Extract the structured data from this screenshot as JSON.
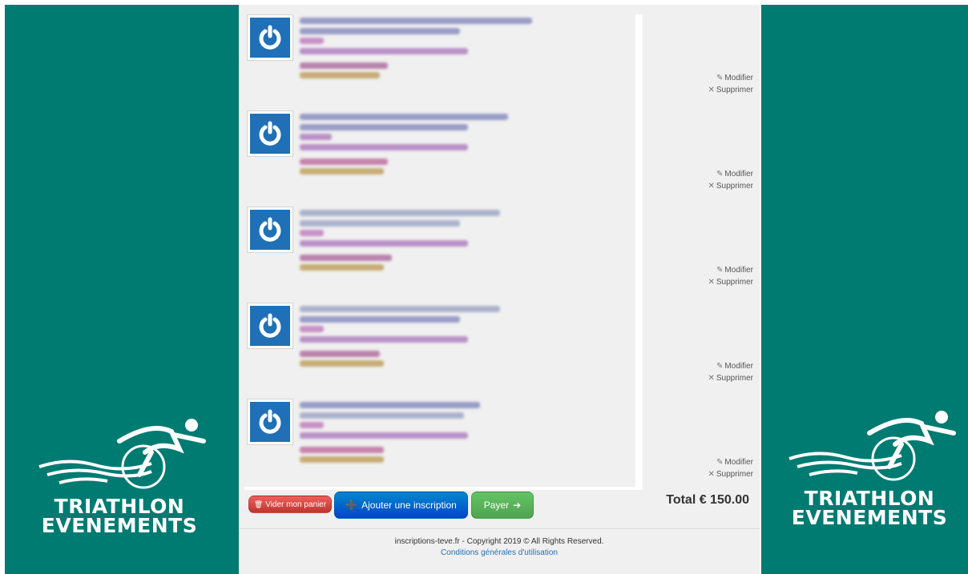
{
  "brand": {
    "logo_line1": "TRIATHLON",
    "logo_line2": "EVENEMENTS",
    "bg_color": "#007b72"
  },
  "cart": {
    "items": [
      {
        "edit_label": "Modifier",
        "delete_label": "Supprimer",
        "thumb_icon": "power-icon"
      },
      {
        "edit_label": "Modifier",
        "delete_label": "Supprimer",
        "thumb_icon": "power-icon"
      },
      {
        "edit_label": "Modifier",
        "delete_label": "Supprimer",
        "thumb_icon": "power-icon"
      },
      {
        "edit_label": "Modifier",
        "delete_label": "Supprimer",
        "thumb_icon": "power-icon"
      },
      {
        "edit_label": "Modifier",
        "delete_label": "Supprimer",
        "thumb_icon": "power-icon"
      }
    ],
    "clear_label": "Vider mon panier",
    "add_label": "Ajouter une inscription",
    "pay_label": "Payer",
    "total_text": "Total € 150.00"
  },
  "colors": {
    "clear": "#bd362f",
    "add": "#0044cc",
    "pay": "#51a351",
    "thumb": "#1f70b7"
  },
  "footer": {
    "copyright": "inscriptions-teve.fr - Copyright 2019 © All Rights Reserved.",
    "cgu": "Conditions générales d'utilisation"
  }
}
